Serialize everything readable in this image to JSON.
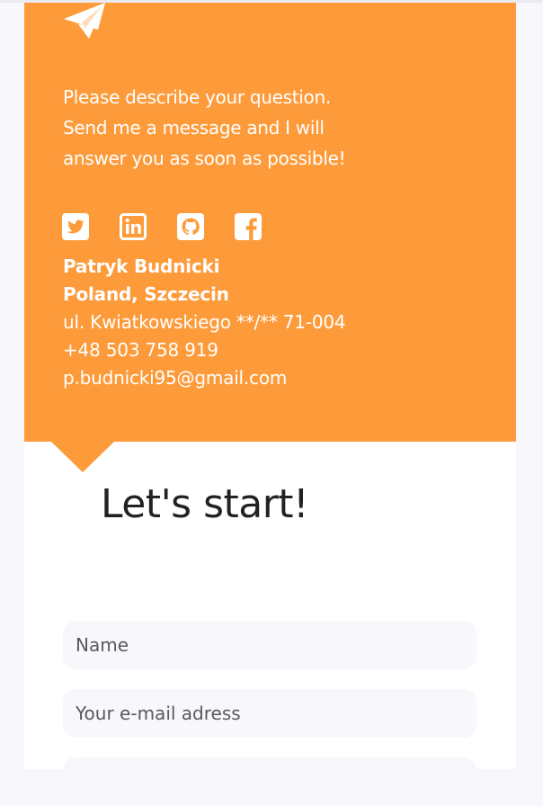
{
  "intro": {
    "line1": "Please describe your question.",
    "line2": "Send me a message and I will",
    "line3": "answer you as soon as possible!"
  },
  "socials": [
    {
      "icon": "twitter-icon"
    },
    {
      "icon": "linkedin-icon"
    },
    {
      "icon": "github-icon"
    },
    {
      "icon": "facebook-icon"
    }
  ],
  "contact": {
    "name": "Patryk Budnicki",
    "location": "Poland, Szczecin",
    "address": "ul. Kwiatkowskiego **/** 71-004",
    "phone": "+48 503 758 919",
    "email": "p.budnicki95@gmail.com"
  },
  "form": {
    "heading": "Let's start!",
    "name_placeholder": "Name",
    "email_placeholder": "Your e-mail adress",
    "third_placeholder": ""
  },
  "colors": {
    "accent": "#fd9b3b",
    "page_bg": "#f7f7fc",
    "field_bg": "#f7f7fc",
    "heading": "#222222"
  }
}
